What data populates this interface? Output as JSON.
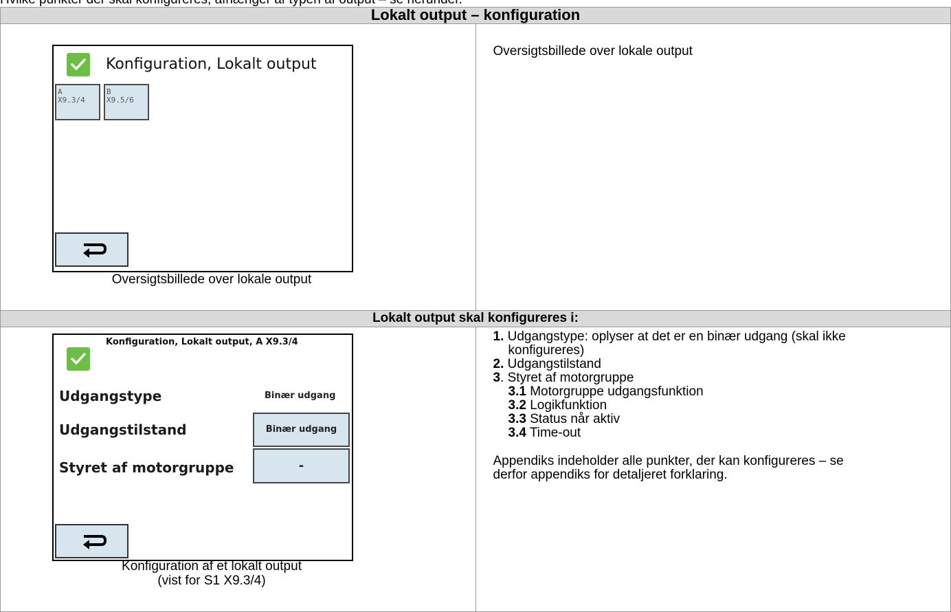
{
  "lead_text": "Hvilke punkter der skal konfigureres, afhænger af typen af output – se herunder.",
  "section1": {
    "header": "Lokalt output – konfiguration",
    "screen": {
      "title": "Konfiguration, Lokalt output",
      "tiles": [
        {
          "line1": "A",
          "line2": "X9.3/4"
        },
        {
          "line1": "B",
          "line2": "X9.5/6"
        }
      ]
    },
    "caption": "Oversigtsbillede over lokale output",
    "description": "Oversigtsbillede over lokale output"
  },
  "section2": {
    "header": "Lokalt output skal konfigureres i:",
    "screen": {
      "title": "Konfiguration, Lokalt output, A X9.3/4",
      "rows": [
        {
          "label": "Udgangstype",
          "value": "Binær udgang"
        },
        {
          "label": "Udgangstilstand",
          "value": "Binær udgang"
        },
        {
          "label": "Styret af motorgruppe",
          "value": "-"
        }
      ]
    },
    "caption_line1": "Konfiguration af et lokalt output",
    "caption_line2": "(vist for S1 X9.3/4)",
    "steps": [
      {
        "num": "1.",
        "text": "Udgangstype: oplyser at det er en binær udgang (skal ikke",
        "cont": "konfigureres)"
      },
      {
        "num": "2.",
        "text": "Udgangstilstand"
      },
      {
        "num": "3",
        "text": ". Styret af motorgruppe"
      }
    ],
    "substeps": [
      {
        "num": "3.1",
        "text": "Motorgruppe udgangsfunktion"
      },
      {
        "num": "3.2",
        "text": "Logikfunktion"
      },
      {
        "num": "3.3",
        "text": "Status når aktiv"
      },
      {
        "num": "3.4",
        "text": "Time-out"
      }
    ],
    "appendix_line1": "Appendiks indeholder alle punkter, der kan konfigureres – se",
    "appendix_line2": "derfor appendiks for detaljeret forklaring."
  },
  "colors": {
    "check_green": "#6cbe45",
    "tile_blue": "#d7e6ee",
    "header_grey": "#d9d9d9"
  },
  "icons": {
    "check": "check-icon",
    "back": "return-arrow-icon"
  }
}
